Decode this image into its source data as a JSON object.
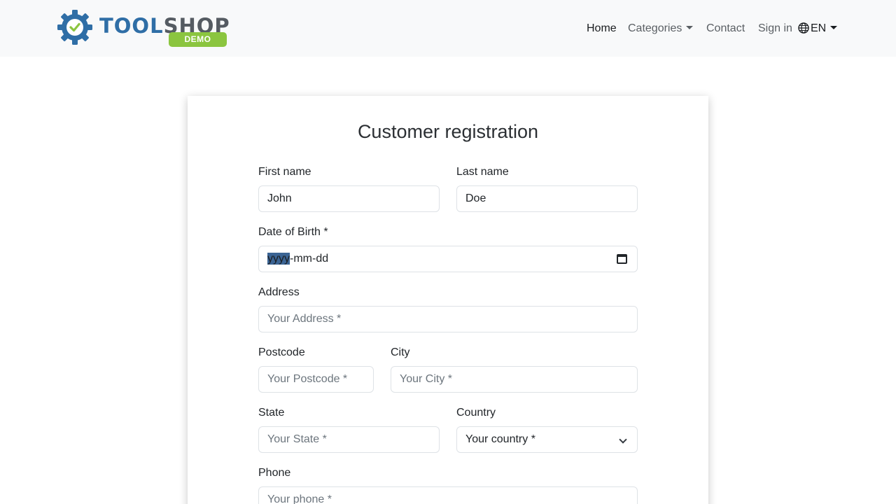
{
  "brand": {
    "tool": "TOOL",
    "shop": "SHOP",
    "badge": "DEMO"
  },
  "nav": {
    "home": "Home",
    "categories": "Categories",
    "contact": "Contact",
    "sign_in": "Sign in",
    "language": "EN"
  },
  "form": {
    "title": "Customer registration",
    "first_name": {
      "label": "First name",
      "value": "John"
    },
    "last_name": {
      "label": "Last name",
      "value": "Doe"
    },
    "dob": {
      "label": "Date of Birth *",
      "selected_segment": "yyyy",
      "rest": "-mm-dd"
    },
    "address": {
      "label": "Address",
      "placeholder": "Your Address *"
    },
    "postcode": {
      "label": "Postcode",
      "placeholder": "Your Postcode *"
    },
    "city": {
      "label": "City",
      "placeholder": "Your City *"
    },
    "state": {
      "label": "State",
      "placeholder": "Your State *"
    },
    "country": {
      "label": "Country",
      "selected": "Your country *"
    },
    "phone": {
      "label": "Phone",
      "placeholder": "Your phone *"
    }
  },
  "icons": {
    "gear": "gear-check-icon",
    "globe": "globe-icon",
    "calendar": "calendar-icon",
    "chevron": "chevron-down-icon"
  },
  "colors": {
    "brand_blue": "#2f6ea6",
    "brand_gray": "#555b62",
    "badge_green": "#8bc53f"
  }
}
